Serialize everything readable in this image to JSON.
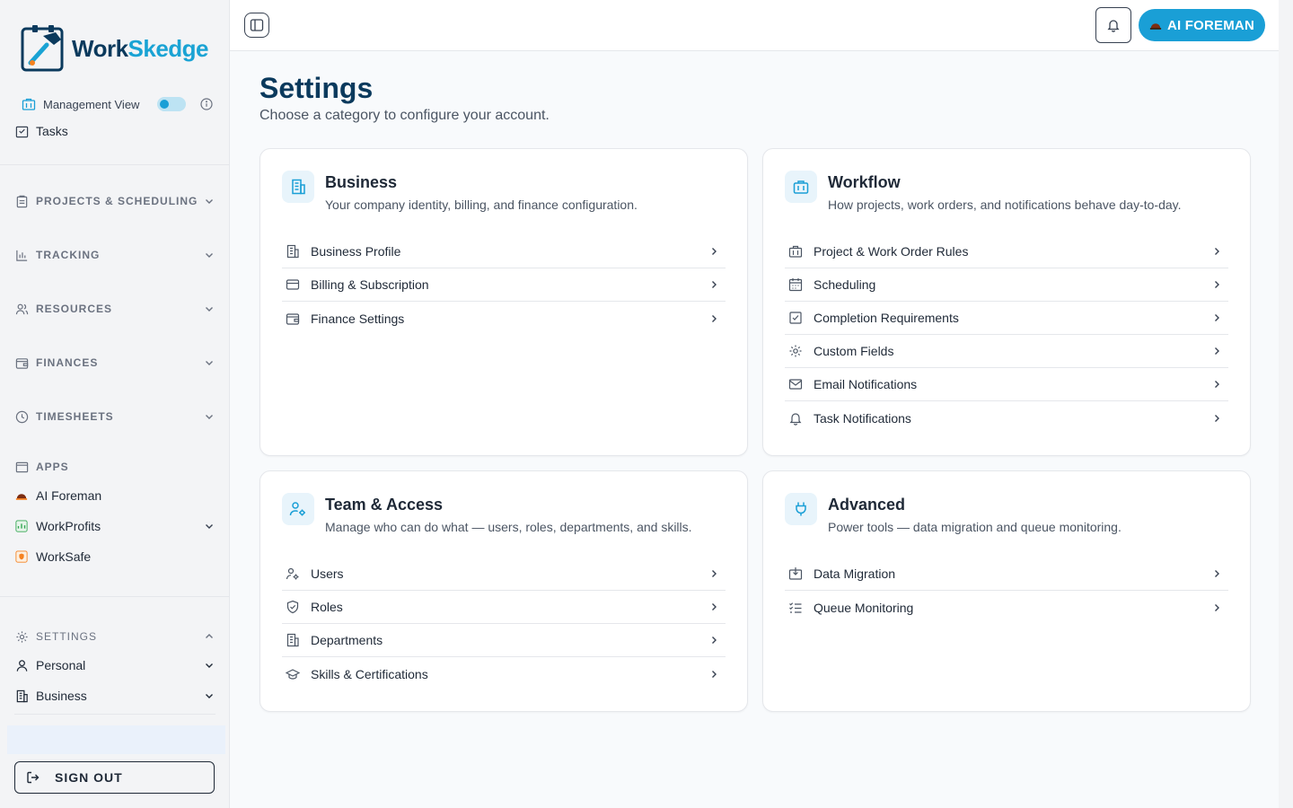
{
  "brand": {
    "name_part1": "Work",
    "name_part2": "Skedge"
  },
  "sidebar": {
    "management_view_label": "Management View",
    "management_view_on": true,
    "cut_item": "Tasks",
    "sections": [
      {
        "label": "PROJECTS & SCHEDULING",
        "icon": "clipboard-icon"
      },
      {
        "label": "TRACKING",
        "icon": "bar-chart-icon"
      },
      {
        "label": "RESOURCES",
        "icon": "users-icon"
      },
      {
        "label": "FINANCES",
        "icon": "wallet-icon"
      },
      {
        "label": "TIMESHEETS",
        "icon": "clock-icon"
      }
    ],
    "apps": {
      "label": "APPS",
      "items": [
        {
          "label": "AI Foreman",
          "icon": "hardhat-icon"
        },
        {
          "label": "WorkProfits",
          "icon": "profits-icon"
        },
        {
          "label": "WorkSafe",
          "icon": "worksafe-icon"
        }
      ]
    },
    "settings": {
      "label": "SETTINGS",
      "items": [
        {
          "label": "Personal",
          "icon": "user-icon"
        },
        {
          "label": "Business",
          "icon": "building-icon"
        }
      ]
    },
    "sign_out_label": "SIGN OUT"
  },
  "topbar": {
    "ai_button_label": "AI FOREMAN"
  },
  "page": {
    "title": "Settings",
    "subtitle": "Choose a category to configure your account."
  },
  "cards": {
    "business": {
      "title": "Business",
      "description": "Your company identity, billing, and finance configuration.",
      "items": [
        "Business Profile",
        "Billing & Subscription",
        "Finance Settings"
      ]
    },
    "workflow": {
      "title": "Workflow",
      "description": "How projects, work orders, and notifications behave day-to-day.",
      "items": [
        "Project & Work Order Rules",
        "Scheduling",
        "Completion Requirements",
        "Custom Fields",
        "Email Notifications",
        "Task Notifications"
      ]
    },
    "team": {
      "title": "Team & Access",
      "description": "Manage who can do what — users, roles, departments, and skills.",
      "items": [
        "Users",
        "Roles",
        "Departments",
        "Skills & Certifications"
      ]
    },
    "advanced": {
      "title": "Advanced",
      "description": "Power tools — data migration and queue monitoring.",
      "items": [
        "Data Migration",
        "Queue Monitoring"
      ]
    }
  },
  "colors": {
    "brand_navy": "#0b3a5d",
    "accent_blue": "#1a9fd6"
  }
}
